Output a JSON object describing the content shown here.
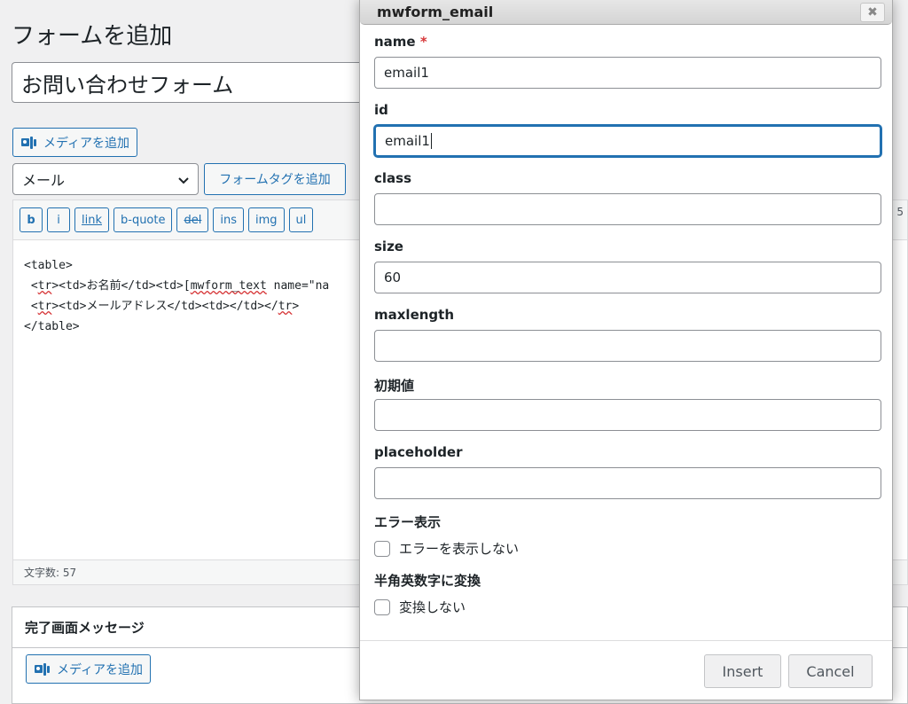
{
  "page": {
    "heading": "フォームを追加",
    "title_value": "お問い合わせフォーム"
  },
  "media_button": {
    "label": "メディアを追加"
  },
  "form_select": {
    "value": "メール"
  },
  "form_tag_button": {
    "label": "フォームタグを追加"
  },
  "quicktags": [
    "b",
    "i",
    "link",
    "b-quote",
    "del",
    "ins",
    "img",
    "ul"
  ],
  "editor": {
    "line1": "<table>",
    "line2_pre": " <",
    "line2_tr": "tr",
    "line2_mid": "><td>お名前</td><td>[",
    "line2_mw": "mwform_text",
    "line2_post": " name=\"na",
    "line3_pre": " <",
    "line3_tr": "tr",
    "line3_mid": "><td>メールアドレス</td><td></td></",
    "line3_tr2": "tr",
    "line3_post": ">",
    "line4": "</table>",
    "word_count": "文字数: 57",
    "status_right": "5"
  },
  "postbox": {
    "title": "完了画面メッセージ",
    "media_label": "メディアを追加"
  },
  "modal": {
    "title": "mwform_email",
    "close_glyph": "✖",
    "fields": {
      "name_label": "name",
      "name_required": "*",
      "name_value": "email1",
      "id_label": "id",
      "id_value": "email1",
      "class_label": "class",
      "class_value": "",
      "size_label": "size",
      "size_value": "60",
      "maxlength_label": "maxlength",
      "maxlength_value": "",
      "initial_label": "初期値",
      "initial_value": "",
      "placeholder_label": "placeholder",
      "placeholder_value": ""
    },
    "error_section": "エラー表示",
    "error_checkbox": "エラーを表示しない",
    "convert_section": "半角英数字に変換",
    "convert_checkbox": "変換しない",
    "insert_label": "Insert",
    "cancel_label": "Cancel"
  }
}
